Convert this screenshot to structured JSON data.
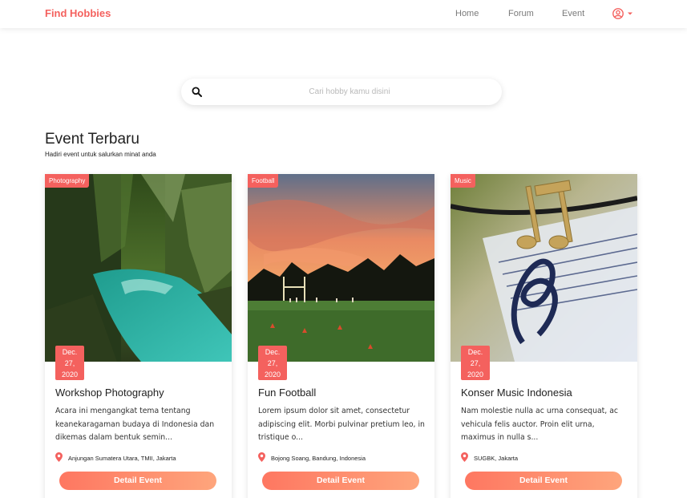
{
  "brand": "Find Hobbies",
  "nav": {
    "home": "Home",
    "forum": "Forum",
    "event": "Event"
  },
  "user_menu": {
    "icon": "user-circle-icon",
    "caret_icon": "caret-down-icon"
  },
  "search": {
    "placeholder": "Cari hobby kamu disini",
    "value": "",
    "icon": "search-icon"
  },
  "section": {
    "title": "Event Terbaru",
    "subtitle": "Hadiri event untuk salurkan minat anda"
  },
  "cards": [
    {
      "category": "Photography",
      "date_month": "Dec.",
      "date_day": "27,",
      "date_year": "2020",
      "title": "Workshop Photography",
      "description": "Acara ini mengangkat tema tentang keanekaragaman budaya di Indonesia dan dikemas dalam bentuk semin...",
      "location": "Anjungan Sumatera Utara, TMII, Jakarta",
      "button": "Detail Event"
    },
    {
      "category": "Football",
      "date_month": "Dec.",
      "date_day": "27,",
      "date_year": "2020",
      "title": "Fun Football",
      "description": "Lorem ipsum dolor sit amet, consectetur adipiscing elit. Morbi pulvinar pretium leo, in tristique o...",
      "location": "Bojong Soang, Bandung, Indonesia",
      "button": "Detail Event"
    },
    {
      "category": "Music",
      "date_month": "Dec.",
      "date_day": "27,",
      "date_year": "2020",
      "title": "Konser Music Indonesia",
      "description": "Nam molestie nulla ac urna consequat, ac vehicula felis auctor. Proin elit urna, maximus in nulla s...",
      "location": "SUGBK, Jakarta",
      "button": "Detail Event"
    }
  ],
  "colors": {
    "accent": "#f4615e",
    "button_start": "#fe7761",
    "button_end": "#fea57c"
  }
}
